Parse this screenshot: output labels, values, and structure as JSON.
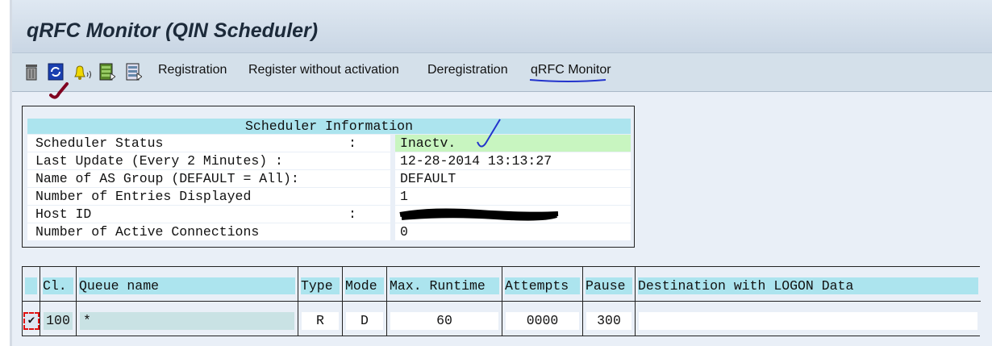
{
  "title": "qRFC Monitor (QIN Scheduler)",
  "toolbar": {
    "icons": [
      "trash-icon",
      "refresh-icon",
      "bell-icon",
      "list-green-icon",
      "list-icon"
    ],
    "items": [
      "Registration",
      "Register without activation",
      "Deregistration",
      "qRFC Monitor"
    ]
  },
  "scheduler_info": {
    "heading": "Scheduler Information",
    "rows": [
      {
        "label": "Scheduler Status",
        "colon": ":",
        "value": "Inactv."
      },
      {
        "label": "Last Update (Every 2 Minutes)  :",
        "colon": "",
        "value": "12-28-2014 13:13:27"
      },
      {
        "label": "Name of AS Group (DEFAULT = All):",
        "colon": "",
        "value": "DEFAULT"
      },
      {
        "label": "Number of Entries Displayed",
        "colon": "",
        "value": "1"
      },
      {
        "label": "Host ID",
        "colon": ":",
        "value": ""
      },
      {
        "label": "Number of Active Connections",
        "colon": "",
        "value": "0"
      }
    ],
    "status_color": "#c8f5c0"
  },
  "table": {
    "headers": [
      "",
      "Cl.",
      "Queue name",
      "Type",
      "Mode",
      "Max. Runtime",
      "Attempts",
      "Pause",
      "Destination with LOGON Data"
    ],
    "row": {
      "checked": true,
      "client": "100",
      "queue": "*",
      "type": "R",
      "mode": "D",
      "max_runtime": "60",
      "attempts": "0000",
      "pause": "300",
      "destination": ""
    }
  }
}
